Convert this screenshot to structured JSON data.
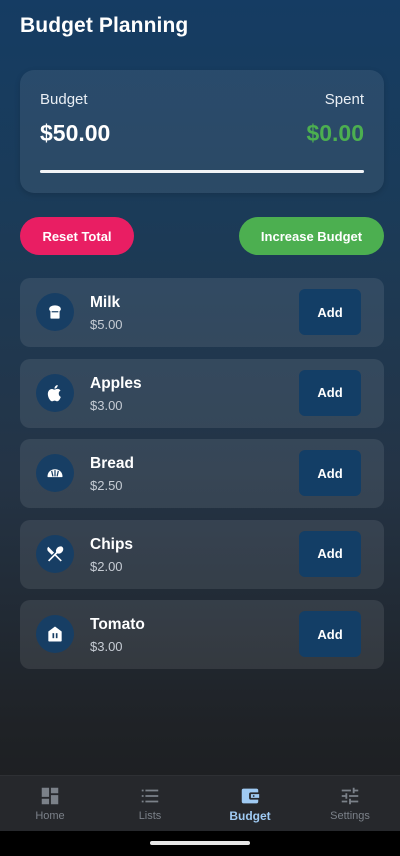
{
  "header": {
    "title": "Budget Planning"
  },
  "summary": {
    "budget_label": "Budget",
    "budget_value": "$50.00",
    "spent_label": "Spent",
    "spent_value": "$0.00",
    "spent_fraction": 0.0,
    "spent_color": "#4caf50"
  },
  "actions": {
    "reset_label": "Reset Total",
    "increase_label": "Increase Budget",
    "reset_color": "#e91e63",
    "increase_color": "#4caf50"
  },
  "items": [
    {
      "name": "Milk",
      "price": "$5.00",
      "icon": "fridge-icon",
      "add_label": "Add"
    },
    {
      "name": "Apples",
      "price": "$3.00",
      "icon": "apple-icon",
      "add_label": "Add"
    },
    {
      "name": "Bread",
      "price": "$2.50",
      "icon": "bakery-icon",
      "add_label": "Add"
    },
    {
      "name": "Chips",
      "price": "$2.00",
      "icon": "utensils-icon",
      "add_label": "Add"
    },
    {
      "name": "Tomato",
      "price": "$3.00",
      "icon": "store-icon",
      "add_label": "Add"
    }
  ],
  "nav": {
    "items": [
      {
        "label": "Home",
        "icon": "dashboard-icon",
        "active": false
      },
      {
        "label": "Lists",
        "icon": "list-icon",
        "active": false
      },
      {
        "label": "Budget",
        "icon": "wallet-icon",
        "active": true
      },
      {
        "label": "Settings",
        "icon": "tune-icon",
        "active": false
      }
    ],
    "active_color": "#9fcaf3"
  }
}
